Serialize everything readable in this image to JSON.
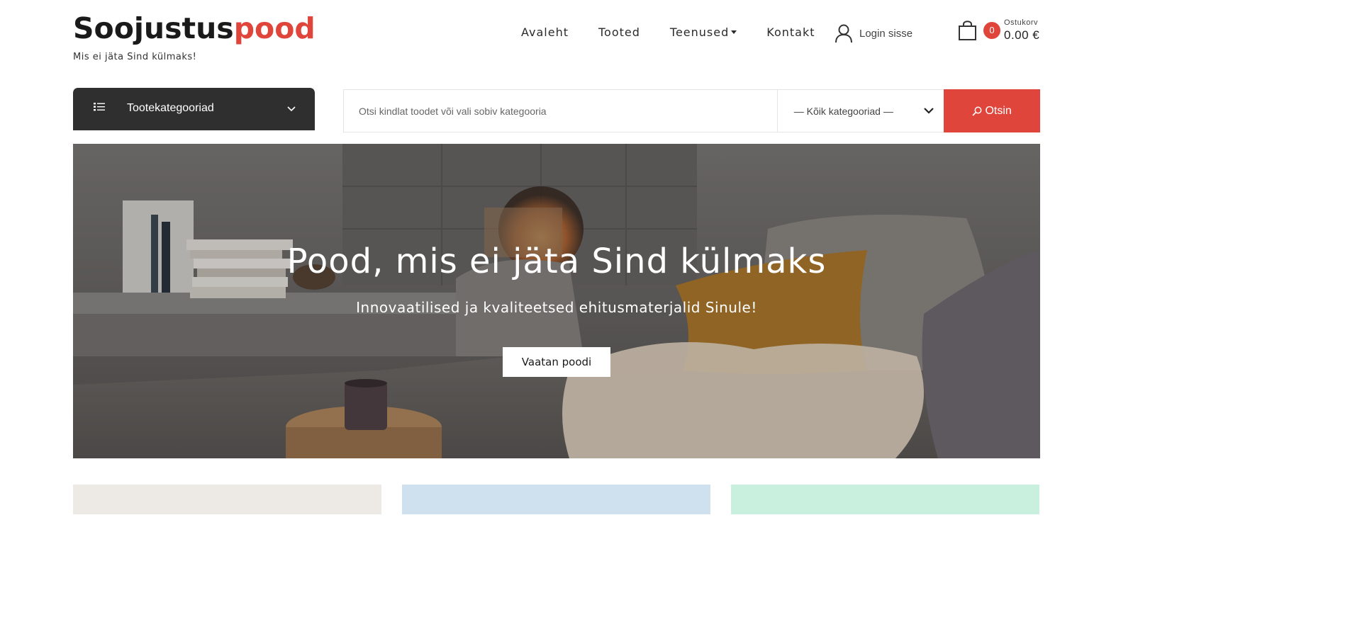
{
  "brand": {
    "name_part1": "Soojustus",
    "name_part2": "pood",
    "tagline": "Mis ei jäta Sind külmaks!",
    "accent_color": "#e0453c"
  },
  "nav": {
    "items": [
      {
        "label": "Avaleht"
      },
      {
        "label": "Tooted"
      },
      {
        "label": "Teenused",
        "has_dropdown": true
      },
      {
        "label": "Kontakt"
      }
    ],
    "login_label": "Login sisse",
    "login_icon": "user-icon"
  },
  "cart": {
    "icon": "shopping-bag-icon",
    "count": "0",
    "label": "Ostukorv",
    "total": "0.00 €"
  },
  "categories": {
    "label": "Tootekategooriad",
    "icon": "list-icon"
  },
  "search": {
    "placeholder": "Otsi kindlat toodet või vali sobiv kategooria",
    "selected_category": "— Kõik kategooriad —",
    "button_label": "Otsin",
    "button_icon": "search-icon"
  },
  "hero": {
    "title": "Pood, mis ei jäta Sind külmaks",
    "subtitle": "Innovaatilised ja kvaliteetsed ehitusmaterjalid Sinule!",
    "button_label": "Vaatan poodi"
  }
}
